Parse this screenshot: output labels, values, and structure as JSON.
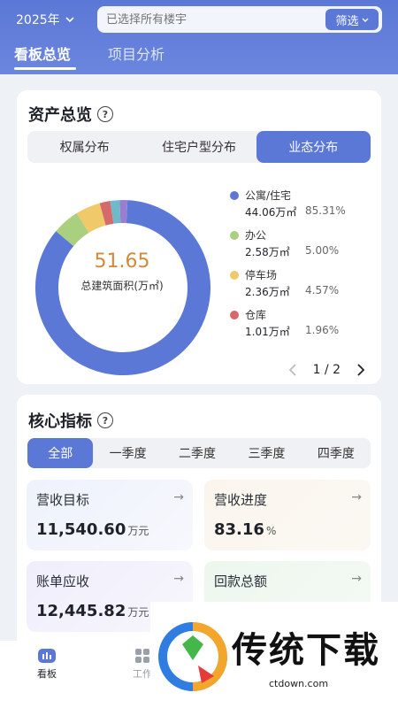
{
  "header": {
    "year": "2025年",
    "search_placeholder": "已选择所有楼宇",
    "filter_label": "筛选",
    "tabs": [
      {
        "label": "看板总览",
        "active": true
      },
      {
        "label": "项目分析",
        "active": false
      }
    ]
  },
  "asset": {
    "title": "资产总览",
    "segments": [
      {
        "label": "权属分布",
        "active": false
      },
      {
        "label": "住宅户型分布",
        "active": false
      },
      {
        "label": "业态分布",
        "active": true
      }
    ],
    "total_value": "51.65",
    "total_label": "总建筑面积(万㎡)",
    "legend": [
      {
        "name": "公寓/住宅",
        "value": "44.06万㎡",
        "pct": "85.31%",
        "color": "#5b78d6",
        "share": 85.31
      },
      {
        "name": "办公",
        "value": "2.58万㎡",
        "pct": "5.00%",
        "color": "#a9cf7f",
        "share": 5.0
      },
      {
        "name": "停车场",
        "value": "2.36万㎡",
        "pct": "4.57%",
        "color": "#f0c96b",
        "share": 4.57
      },
      {
        "name": "仓库",
        "value": "1.01万㎡",
        "pct": "1.96%",
        "color": "#d46a6a",
        "share": 1.96
      }
    ],
    "pager": "1 / 2"
  },
  "metrics": {
    "title": "核心指标",
    "quarters": [
      {
        "label": "全部",
        "active": true
      },
      {
        "label": "一季度",
        "active": false
      },
      {
        "label": "二季度",
        "active": false
      },
      {
        "label": "三季度",
        "active": false
      },
      {
        "label": "四季度",
        "active": false
      }
    ],
    "cards": [
      {
        "title": "营收目标",
        "value": "11,540.60",
        "unit": "万元"
      },
      {
        "title": "营收进度",
        "value": "83.16",
        "unit": "%"
      },
      {
        "title": "账单应收",
        "value": "12,445.82",
        "unit": "万元"
      },
      {
        "title": "回款总额",
        "value": "",
        "unit": ""
      }
    ]
  },
  "nav": {
    "items": [
      {
        "label": "看板"
      },
      {
        "label": "工作"
      }
    ]
  },
  "watermark": {
    "text": "传统下载",
    "url": "ctdown.com"
  }
}
